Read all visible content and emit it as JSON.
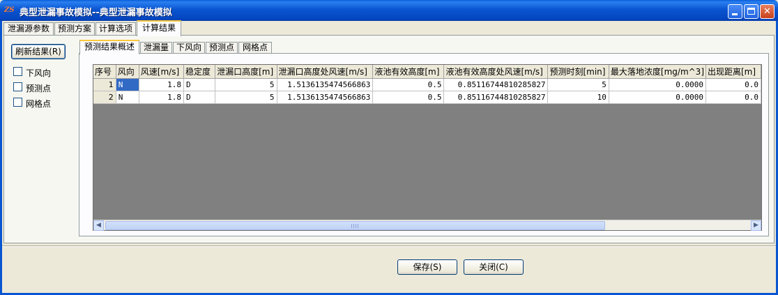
{
  "window": {
    "icon_text": "ZS",
    "title": "典型泄漏事故模拟--典型泄漏事故模拟"
  },
  "outer_tabs": [
    "泄漏源参数",
    "预测方案",
    "计算选项",
    "计算结果"
  ],
  "outer_active": "计算结果",
  "left": {
    "refresh_label": "刷新结果(R)",
    "checkboxes": [
      {
        "label": "下风向",
        "checked": false
      },
      {
        "label": "预测点",
        "checked": false
      },
      {
        "label": "网格点",
        "checked": false
      }
    ]
  },
  "inner_tabs": [
    "预测结果概述",
    "泄漏量",
    "下风向",
    "预测点",
    "网格点"
  ],
  "inner_active": "预测结果概述",
  "grid": {
    "columns": [
      "序号",
      "风向",
      "风速[m/s]",
      "稳定度",
      "泄漏口高度[m]",
      "泄漏口高度处风速[m/s]",
      "液池有效高度[m]",
      "液池有效高度处风速[m/s]",
      "预测时刻[min]",
      "最大落地浓度[mg/m^3]",
      "出现距离[m]"
    ],
    "rows": [
      [
        "1",
        "N",
        "1.8",
        "D",
        "5",
        "1.5136135474566863",
        "0.5",
        "0.85116744810285827",
        "5",
        "0.0000",
        "0.0"
      ],
      [
        "2",
        "N",
        "1.8",
        "D",
        "5",
        "1.5136135474566863",
        "0.5",
        "0.85116744810285827",
        "10",
        "0.0000",
        "0.0"
      ]
    ]
  },
  "footer": {
    "save_label": "保存(S)",
    "close_label": "关闭(C)"
  }
}
